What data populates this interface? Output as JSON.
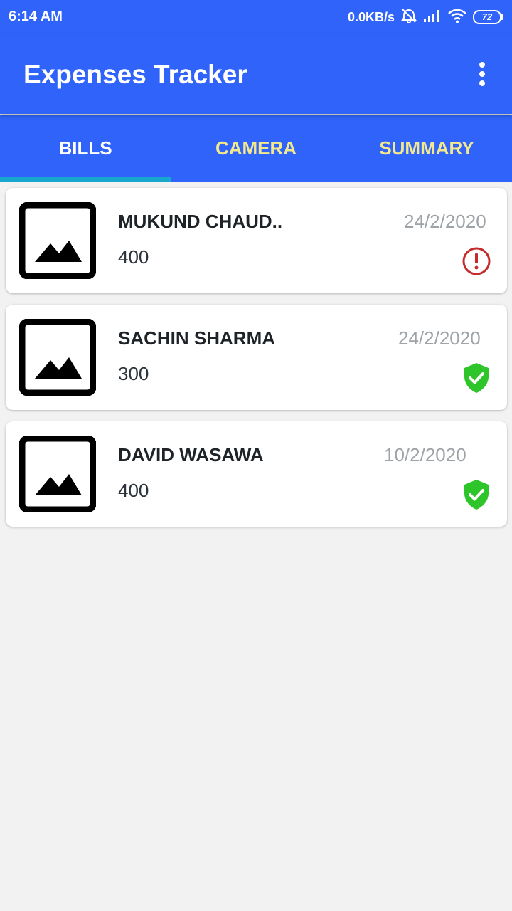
{
  "status_bar": {
    "time": "6:14 AM",
    "net_speed": "0.0KB/s",
    "battery": "72"
  },
  "app_bar": {
    "title": "Expenses Tracker",
    "menu_icon": "more-vert-icon"
  },
  "tabs": [
    {
      "label": "BILLS",
      "active": true
    },
    {
      "label": "CAMERA",
      "active": false
    },
    {
      "label": "SUMMARY",
      "active": false
    }
  ],
  "bills": [
    {
      "name": "MUKUND CHAUD..",
      "amount": "400",
      "date": "24/2/2020",
      "status": "error",
      "status_icon": "alert-circle-icon"
    },
    {
      "name": "SACHIN SHARMA",
      "amount": "300",
      "date": "24/2/2020",
      "status": "verified",
      "status_icon": "shield-check-icon"
    },
    {
      "name": "DAVID WASAWA",
      "amount": "400",
      "date": "10/2/2020",
      "status": "verified",
      "status_icon": "shield-check-icon"
    }
  ],
  "colors": {
    "primary": "#2f63fa",
    "tab_inactive": "#f3e98c",
    "tab_indicator": "#18a8cf",
    "error": "#c62b2b",
    "verified": "#2ec52a"
  }
}
